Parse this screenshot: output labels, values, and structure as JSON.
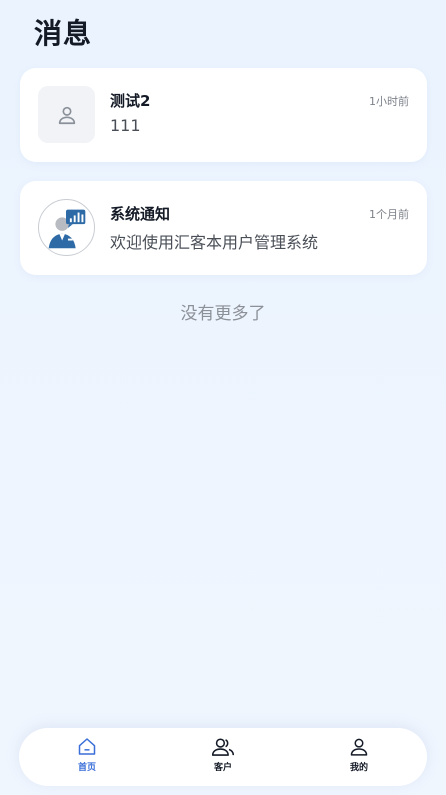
{
  "header": {
    "title": "消息"
  },
  "messages": [
    {
      "name": "测试2",
      "preview": "111",
      "time": "1小时前"
    },
    {
      "name": "系统通知",
      "preview": "欢迎使用汇客本用户管理系统",
      "time": "1个月前"
    }
  ],
  "list_footer": "没有更多了",
  "tabbar": {
    "items": [
      {
        "label": "首页",
        "icon": "home-icon",
        "active": true
      },
      {
        "label": "客户",
        "icon": "customers-icon",
        "active": false
      },
      {
        "label": "我的",
        "icon": "profile-icon",
        "active": false
      }
    ]
  },
  "colors": {
    "accent": "#3a6fd8",
    "background": "#eef5fe",
    "text": "#141a26"
  }
}
